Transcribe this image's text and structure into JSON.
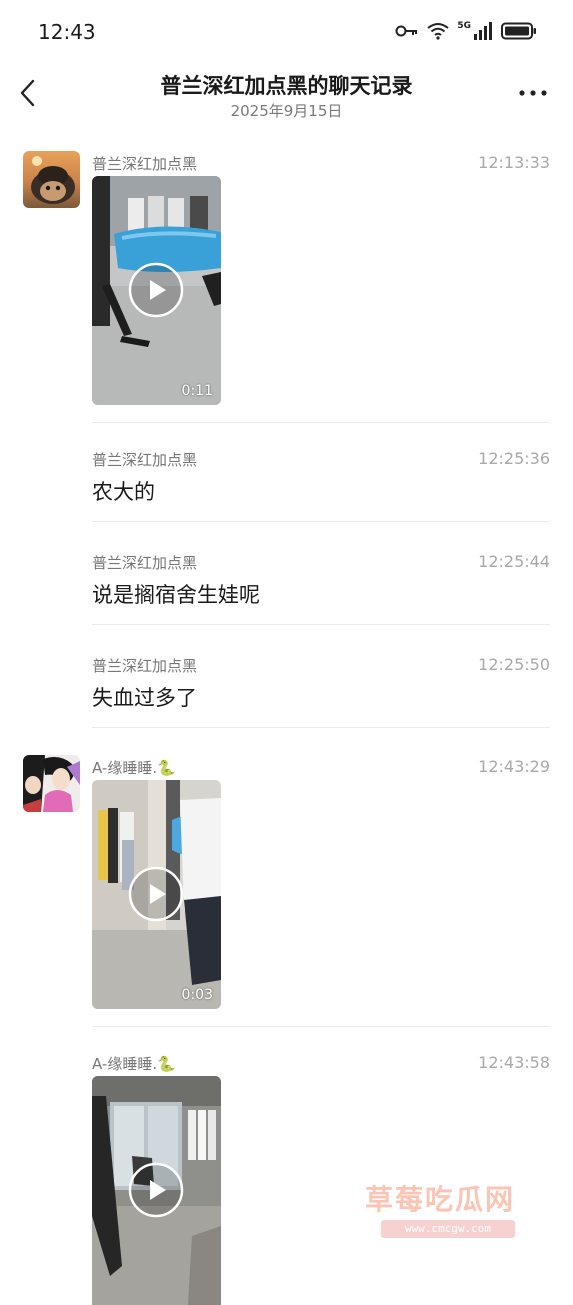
{
  "status": {
    "time": "12:43",
    "network": "5G"
  },
  "header": {
    "title": "普兰深红加点黑的聊天记录",
    "date": "2025年9月15日"
  },
  "messages": [
    {
      "sender": "普兰深红加点黑",
      "time": "12:13:33",
      "type": "video",
      "duration": "0:11"
    },
    {
      "sender": "普兰深红加点黑",
      "time": "12:25:36",
      "type": "text",
      "text": "农大的"
    },
    {
      "sender": "普兰深红加点黑",
      "time": "12:25:44",
      "type": "text",
      "text": "说是搁宿舍生娃呢"
    },
    {
      "sender": "普兰深红加点黑",
      "time": "12:25:50",
      "type": "text",
      "text": "失血过多了"
    },
    {
      "sender": "A-缘睡睡.🐍",
      "time": "12:43:29",
      "type": "video",
      "duration": "0:03"
    },
    {
      "sender": "A-缘睡睡.🐍",
      "time": "12:43:58",
      "type": "video",
      "duration": ""
    }
  ],
  "watermark": {
    "main": "草莓吃瓜网",
    "url": "www.cmcgw.com"
  },
  "icons": [
    "back-icon",
    "more-icon",
    "key-icon",
    "wifi-icon",
    "signal-icon",
    "battery-icon",
    "play-icon"
  ]
}
